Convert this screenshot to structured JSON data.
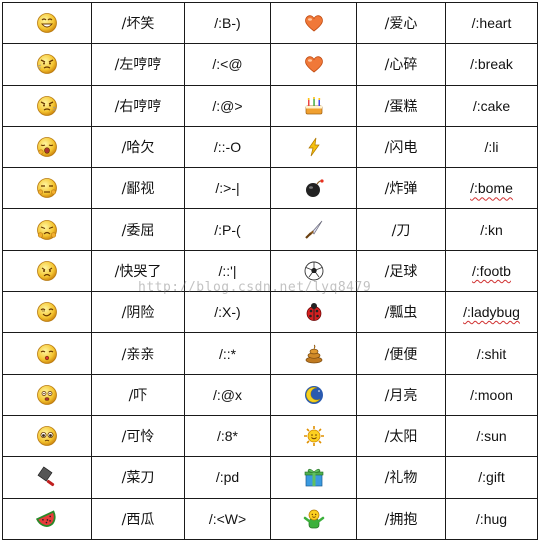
{
  "rows": [
    {
      "left": {
        "icon": "smirk-face-icon",
        "name": "/坏笑",
        "code": "/:B-)"
      },
      "right": {
        "icon": "heart-icon",
        "name": "/爱心",
        "code": "/:heart"
      }
    },
    {
      "left": {
        "icon": "left-humph-face-icon",
        "name": "/左哼哼",
        "code": "/:<@"
      },
      "right": {
        "icon": "broken-heart-icon",
        "name": "/心碎",
        "code": "/:break"
      }
    },
    {
      "left": {
        "icon": "right-humph-face-icon",
        "name": "/右哼哼",
        "code": "/:@>"
      },
      "right": {
        "icon": "cake-icon",
        "name": "/蛋糕",
        "code": "/:cake"
      }
    },
    {
      "left": {
        "icon": "yawn-face-icon",
        "name": "/哈欠",
        "code": "/::-O"
      },
      "right": {
        "icon": "lightning-icon",
        "name": "/闪电",
        "code": "/:li"
      }
    },
    {
      "left": {
        "icon": "disdain-face-icon",
        "name": "/鄙视",
        "code": "/:>-|"
      },
      "right": {
        "icon": "bomb-icon",
        "name": "/炸弹",
        "code": "/:bome"
      }
    },
    {
      "left": {
        "icon": "wronged-face-icon",
        "name": "/委屈",
        "code": "/:P-("
      },
      "right": {
        "icon": "knife-icon",
        "name": "/刀",
        "code": "/:kn"
      }
    },
    {
      "left": {
        "icon": "about-to-cry-face-icon",
        "name": "/快哭了",
        "code": "/::'|"
      },
      "right": {
        "icon": "soccer-ball-icon",
        "name": "/足球",
        "code": "/:footb"
      }
    },
    {
      "left": {
        "icon": "sly-face-icon",
        "name": "/阴险",
        "code": "/:X-)"
      },
      "right": {
        "icon": "ladybug-icon",
        "name": "/瓢虫",
        "code": "/:ladybug"
      }
    },
    {
      "left": {
        "icon": "kiss-face-icon",
        "name": "/亲亲",
        "code": "/::*"
      },
      "right": {
        "icon": "poop-icon",
        "name": "/便便",
        "code": "/:shit"
      }
    },
    {
      "left": {
        "icon": "scared-face-icon",
        "name": "/吓",
        "code": "/:@x"
      },
      "right": {
        "icon": "moon-icon",
        "name": "/月亮",
        "code": "/:moon"
      }
    },
    {
      "left": {
        "icon": "pitiful-face-icon",
        "name": "/可怜",
        "code": "/:8*"
      },
      "right": {
        "icon": "sun-icon",
        "name": "/太阳",
        "code": "/:sun"
      }
    },
    {
      "left": {
        "icon": "cleaver-icon",
        "name": "/菜刀",
        "code": "/:pd"
      },
      "right": {
        "icon": "gift-icon",
        "name": "/礼物",
        "code": "/:gift"
      }
    },
    {
      "left": {
        "icon": "watermelon-icon",
        "name": "/西瓜",
        "code": "/:<W>"
      },
      "right": {
        "icon": "hug-icon",
        "name": "/拥抱",
        "code": "/:hug"
      }
    }
  ],
  "watermark": "http://blog.csdn.net/lyq8479"
}
